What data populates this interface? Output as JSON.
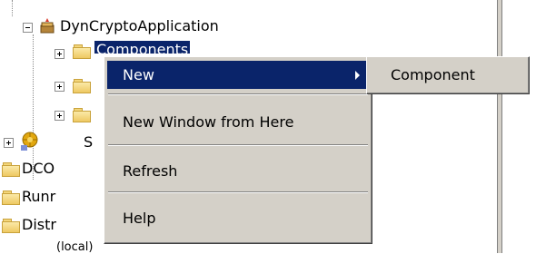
{
  "tree": {
    "root_label": "DynCryptoApplication",
    "selected_child_label": "Components",
    "partial_sibling_label": "S",
    "siblings": [
      "DCO",
      "Runr",
      "Distr"
    ],
    "bottom_partial_text": "(local)"
  },
  "context_menu": {
    "items": [
      {
        "label": "New",
        "has_submenu": true,
        "active": true
      },
      {
        "label": "New Window from Here"
      },
      {
        "label": "Refresh"
      },
      {
        "label": "Help"
      }
    ]
  },
  "submenu": {
    "items": [
      {
        "label": "Component"
      }
    ]
  },
  "colors": {
    "highlight": "#0a246a",
    "menu_face": "#d4d0c8"
  }
}
